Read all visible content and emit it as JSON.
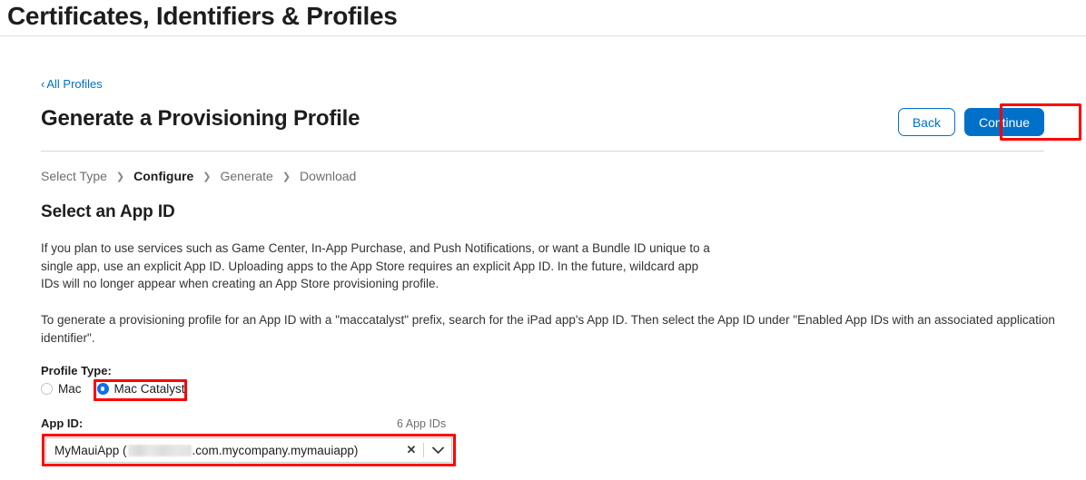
{
  "header": {
    "title": "Certificates, Identifiers & Profiles"
  },
  "breadcrumb": {
    "back_chevron": "‹",
    "back_label": "All Profiles"
  },
  "section": {
    "title": "Generate a Provisioning Profile",
    "buttons": {
      "back_label": "Back",
      "continue_label": "Continue"
    },
    "accent_blue": "#0070c9",
    "highlight_red": "#ff0000"
  },
  "steps": {
    "separator": "❯",
    "items": [
      {
        "label": "Select Type",
        "active": false
      },
      {
        "label": "Configure",
        "active": true
      },
      {
        "label": "Generate",
        "active": false
      },
      {
        "label": "Download",
        "active": false
      }
    ]
  },
  "main": {
    "heading": "Select an App ID",
    "paragraph_1": "If you plan to use services such as Game Center, In-App Purchase, and Push Notifications, or want a Bundle ID unique to a single app, use an explicit App ID. Uploading apps to the App Store requires an explicit App ID. In the future, wildcard app IDs will no longer appear when creating an App Store provisioning profile.",
    "paragraph_2": "To generate a provisioning profile for an App ID with a \"maccatalyst\" prefix, search for the iPad app's App ID. Then select the App ID under \"Enabled App IDs with an associated application identifier\".",
    "profile_type": {
      "label": "Profile Type:",
      "options": [
        {
          "label": "Mac",
          "selected": false
        },
        {
          "label": "Mac Catalyst",
          "selected": true
        }
      ]
    },
    "app_id": {
      "label": "App ID:",
      "count_label": "6 App IDs",
      "selected_prefix": "MyMauiApp (",
      "selected_redacted": "",
      "selected_suffix": ".com.mycompany.mymauiapp)",
      "clear_icon": "✕"
    }
  }
}
